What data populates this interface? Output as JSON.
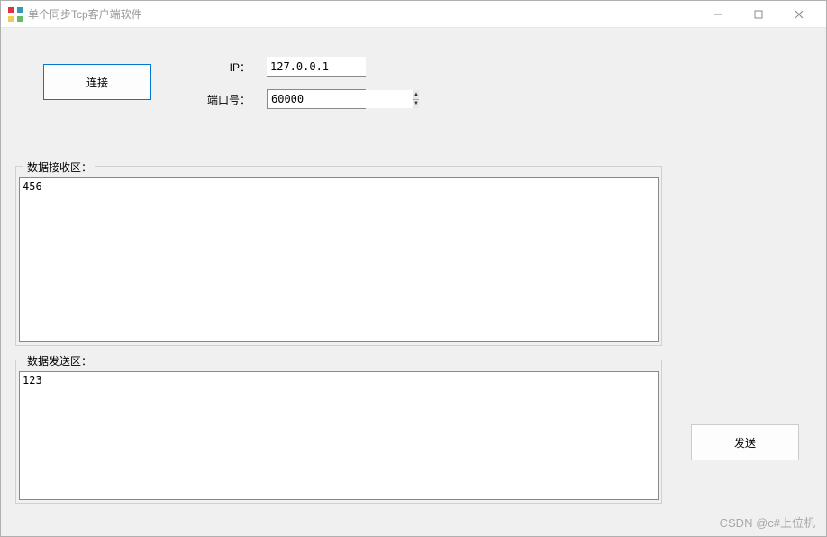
{
  "window": {
    "title": "单个同步Tcp客户端软件"
  },
  "connection": {
    "connect_label": "连接",
    "ip_label": "IP：",
    "ip_value": "127.0.0.1",
    "port_label": "端口号：",
    "port_value": "60000"
  },
  "receive": {
    "group_label": "数据接收区：",
    "content": "456"
  },
  "send": {
    "group_label": "数据发送区：",
    "content": "123",
    "button_label": "发送"
  },
  "watermark": "CSDN @c#上位机"
}
